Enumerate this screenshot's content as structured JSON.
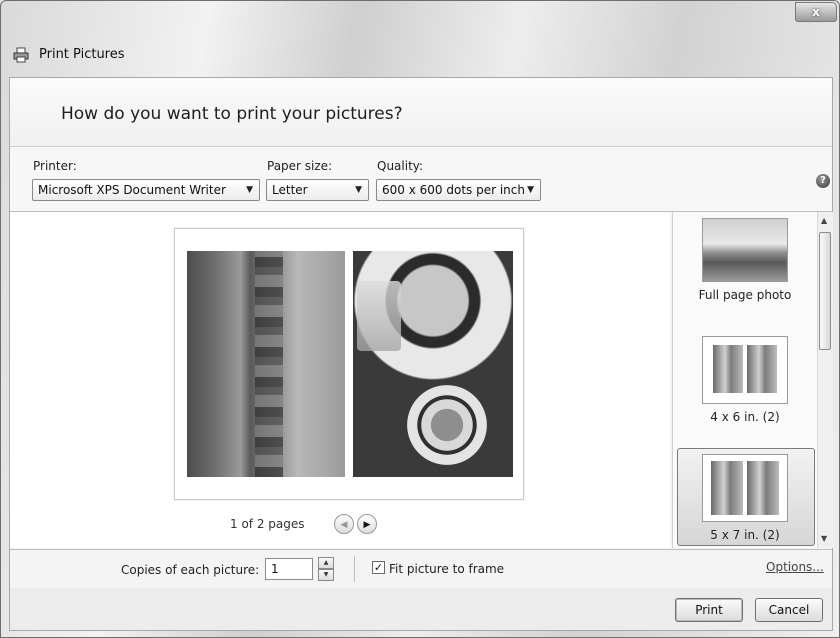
{
  "window": {
    "title": "Print Pictures",
    "close_label": "x"
  },
  "header": {
    "heading": "How do you want to print your pictures?"
  },
  "settings": {
    "printer_label": "Printer:",
    "printer_value": "Microsoft XPS Document Writer",
    "paper_label": "Paper size:",
    "paper_value": "Letter",
    "quality_label": "Quality:",
    "quality_value": "600 x 600 dots per inch",
    "help_icon": "?"
  },
  "preview": {
    "page_count": "1 of 2 pages",
    "prev_icon": "◀",
    "next_icon": "▶"
  },
  "layouts": {
    "items": [
      {
        "label": "Full page photo"
      },
      {
        "label": "4 x 6 in. (2)"
      },
      {
        "label": "5 x 7 in. (2)",
        "selected": true
      }
    ]
  },
  "copies": {
    "label": "Copies of each picture:",
    "value": "1",
    "fit_label": "Fit picture to frame",
    "fit_checked": true,
    "fit_check_glyph": "✓",
    "options_label": "Options..."
  },
  "footer": {
    "print_label": "Print",
    "cancel_label": "Cancel"
  }
}
